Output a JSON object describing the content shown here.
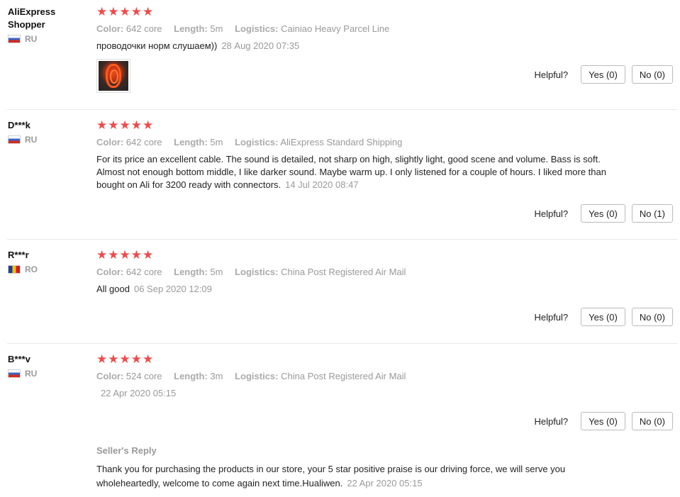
{
  "helpful_label": "Helpful?",
  "attr_labels": {
    "color": "Color:",
    "length": "Length:",
    "logistics": "Logistics:"
  },
  "reviews": [
    {
      "user": "AliExpress Shopper",
      "country": "RU",
      "stars": "★★★★★",
      "color": "642 core",
      "length": "5m",
      "logistics": "Cainiao Heavy Parcel Line",
      "text": "проводочки норм слушаем))",
      "date": "28 Aug 2020 07:35",
      "yes": "Yes (0)",
      "no": "No (0)"
    },
    {
      "user": "D***k",
      "country": "RU",
      "stars": "★★★★★",
      "color": "642 core",
      "length": "5m",
      "logistics": "AliExpress Standard Shipping",
      "text": "For its price an excellent cable. The sound is detailed, not sharp on high, slightly light, good scene and volume. Bass is soft. Almost not enough bottom middle, I like darker sound. Maybe warm up. I only listened for a couple of hours. I liked more than bought on Ali for 3200 ready with connectors.",
      "date": "14 Jul 2020 08:47",
      "yes": "Yes (0)",
      "no": "No (1)"
    },
    {
      "user": "R***r",
      "country": "RO",
      "stars": "★★★★★",
      "color": "642 core",
      "length": "5m",
      "logistics": "China Post Registered Air Mail",
      "text": "All good",
      "date": "06 Sep 2020 12:09",
      "yes": "Yes (0)",
      "no": "No (0)"
    },
    {
      "user": "B***v",
      "country": "RU",
      "stars": "★★★★★",
      "color": "524 core",
      "length": "3m",
      "logistics": "China Post Registered Air Mail",
      "text": "",
      "date": "22 Apr 2020 05:15",
      "yes": "Yes (0)",
      "no": "No (0)",
      "seller_reply": {
        "title": "Seller's Reply",
        "text": "Thank you for purchasing the products in our store, your 5 star positive praise is our driving force, we will serve you wholeheartedly, welcome to come again next time.Hualiwen.",
        "date": "22 Apr 2020 05:15"
      }
    }
  ]
}
